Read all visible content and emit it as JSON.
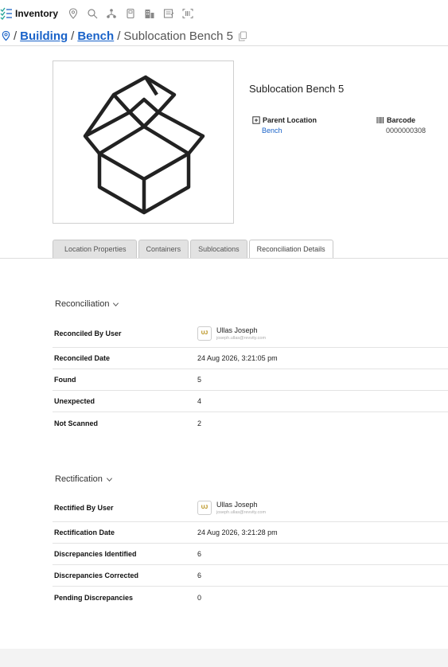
{
  "toolbar": {
    "title": "Inventory",
    "icons": [
      "location-pin-icon",
      "search-icon",
      "hierarchy-icon",
      "scanner-icon",
      "building-icon",
      "notes-icon",
      "barcode-scan-icon"
    ]
  },
  "breadcrumb": {
    "items": [
      "Building",
      "Bench"
    ],
    "separator": "/",
    "current": "Sublocation Bench 5"
  },
  "location": {
    "title": "Sublocation Bench 5",
    "parent_label": "Parent Location",
    "parent_value": "Bench",
    "barcode_label": "Barcode",
    "barcode_value": "0000000308"
  },
  "tabs": [
    "Location Properties",
    "Containers",
    "Sublocations",
    "Reconciliation Details"
  ],
  "reconciliation": {
    "title": "Reconciliation",
    "rows": [
      {
        "label": "Reconciled By User",
        "user_initials": "UJ",
        "user_name": "Ullas Joseph",
        "user_email": "joseph.ullas@revvity.com"
      },
      {
        "label": "Reconciled Date",
        "value": "24 Aug 2026, 3:21:05 pm"
      },
      {
        "label": "Found",
        "value": "5"
      },
      {
        "label": "Unexpected",
        "value": "4"
      },
      {
        "label": "Not Scanned",
        "value": "2"
      }
    ]
  },
  "rectification": {
    "title": "Rectification",
    "rows": [
      {
        "label": "Rectified By User",
        "user_initials": "UJ",
        "user_name": "Ullas Joseph",
        "user_email": "joseph.ullas@revvity.com"
      },
      {
        "label": "Rectification Date",
        "value": "24 Aug 2026, 3:21:28 pm"
      },
      {
        "label": "Discrepancies Identified",
        "value": "6"
      },
      {
        "label": "Discrepancies Corrected",
        "value": "6"
      },
      {
        "label": "Pending Discrepancies",
        "value": "0"
      }
    ]
  },
  "colors": {
    "link": "#1a63c9",
    "accent_icon": "#2aa89a",
    "avatar_text": "#b08400"
  }
}
